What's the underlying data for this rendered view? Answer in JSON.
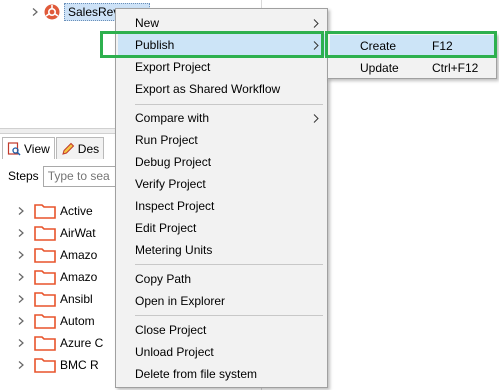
{
  "project_tree": {
    "project_name": "SalesRevenue"
  },
  "bottom_panel": {
    "tabs": [
      {
        "label": "View"
      },
      {
        "label": "Des"
      }
    ],
    "steps_label": "Steps",
    "search_placeholder": "Type to sea",
    "folders": [
      {
        "label": "Active"
      },
      {
        "label": "AirWat"
      },
      {
        "label": "Amazo"
      },
      {
        "label": "Amazo"
      },
      {
        "label": "Ansibl"
      },
      {
        "label": "Autom"
      },
      {
        "label": "Azure C"
      },
      {
        "label": "BMC R"
      }
    ]
  },
  "context_menu": {
    "items": [
      {
        "label": "New",
        "has_submenu": true
      },
      {
        "label": "Publish",
        "has_submenu": true,
        "highlighted": true
      },
      {
        "label": "Export Project"
      },
      {
        "label": "Export as Shared Workflow"
      },
      {
        "label": "Compare with",
        "has_submenu": true
      },
      {
        "label": "Run Project"
      },
      {
        "label": "Debug Project"
      },
      {
        "label": "Verify Project"
      },
      {
        "label": "Inspect Project"
      },
      {
        "label": "Edit Project"
      },
      {
        "label": "Metering Units"
      },
      {
        "label": "Copy Path"
      },
      {
        "label": "Open in Explorer"
      },
      {
        "label": "Close Project"
      },
      {
        "label": "Unload Project"
      },
      {
        "label": "Delete from file system"
      }
    ]
  },
  "publish_submenu": {
    "items": [
      {
        "label": "Create",
        "shortcut": "F12",
        "highlighted": true
      },
      {
        "label": "Update",
        "shortcut": "Ctrl+F12"
      }
    ]
  },
  "colors": {
    "menu_background": "#f2f2f2",
    "menu_highlight": "#cce4f7",
    "annotation_green": "#2db04e",
    "folder_orange": "#e8542b",
    "project_icon_red": "#e05a3a"
  }
}
